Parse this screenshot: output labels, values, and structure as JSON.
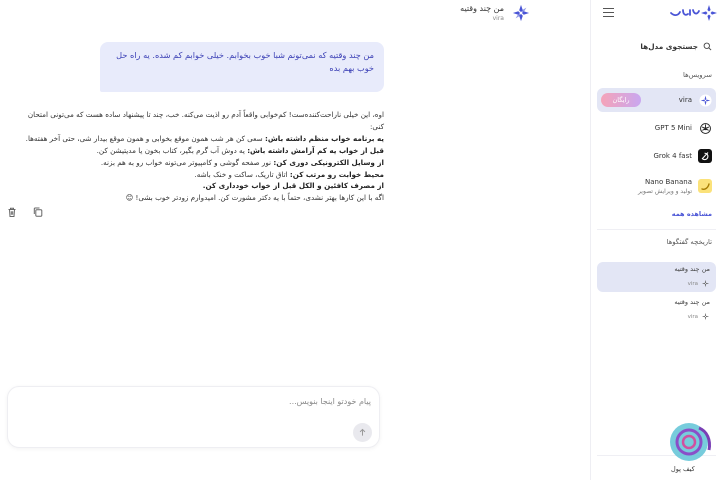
{
  "chat": {
    "title": "من چند وقتیه",
    "model_tag": "vira"
  },
  "user_message": "من چند وقتیه که نمی‌تونم شبا خوب بخوابم. خیلی خوابم کم شده. یه راه حل خوب بهم بده",
  "answer": {
    "intro": "اوه، این خیلی ناراحت‌کننده‌ست! کم‌خوابی واقعاً آدم رو اذیت می‌کنه. خب، چند تا پیشنهاد ساده هست که می‌تونی امتحان کنی:",
    "tips": [
      {
        "bold": "یه برنامه خواب منظم داشته باش:",
        "text": " سعی کن هر شب همون موقع بخوابی و همون موقع بیدار شی، حتی آخر هفته‌ها."
      },
      {
        "bold": "قبل از خواب یه کم آرامش داشته باش:",
        "text": " یه دوش آب گرم بگیر، کتاب بخون یا مدیتیشن کن."
      },
      {
        "bold": "از وسایل الکترونیکی دوری کن:",
        "text": " نور صفحه گوشی و کامپیوتر می‌تونه خواب رو به هم بزنه."
      },
      {
        "bold": "محیط خوابت رو مرتب کن:",
        "text": " اتاق تاریک، ساکت و خنک باشه."
      },
      {
        "bold": "از مصرف کافئین و الکل قبل از خواب خودداری کن.",
        "text": ""
      }
    ],
    "outro": "اگه با این کارها بهتر نشدی، حتماً با یه دکتر مشورت کن. امیدوارم زودتر خوب بشی! 😊"
  },
  "composer": {
    "placeholder": "پیام خودتو اینجا بنویس..."
  },
  "sidebar": {
    "search_label": "جستجوی مدل‌ها",
    "services_label": "سرویس‌ها",
    "models": [
      {
        "name": "vira",
        "badge": "رایگان",
        "sub": ""
      },
      {
        "name": "GPT 5 Mini",
        "sub": ""
      },
      {
        "name": "Grok 4 fast",
        "sub": ""
      },
      {
        "name": "Nano Banana",
        "sub": "تولید و ویرایش تصویر"
      }
    ],
    "see_all": "مشاهده همه",
    "history_label": "تاریخچه گفتگوها",
    "conversations": [
      {
        "title": "من چند وقتیه",
        "model": "vira"
      },
      {
        "title": "من چند وقتیه",
        "model": "vira"
      }
    ],
    "help_label": "کیف پول"
  },
  "colors": {
    "accent": "#4a55d6",
    "bubble": "#e8ebfb",
    "active_bg": "#e3e6f5"
  }
}
